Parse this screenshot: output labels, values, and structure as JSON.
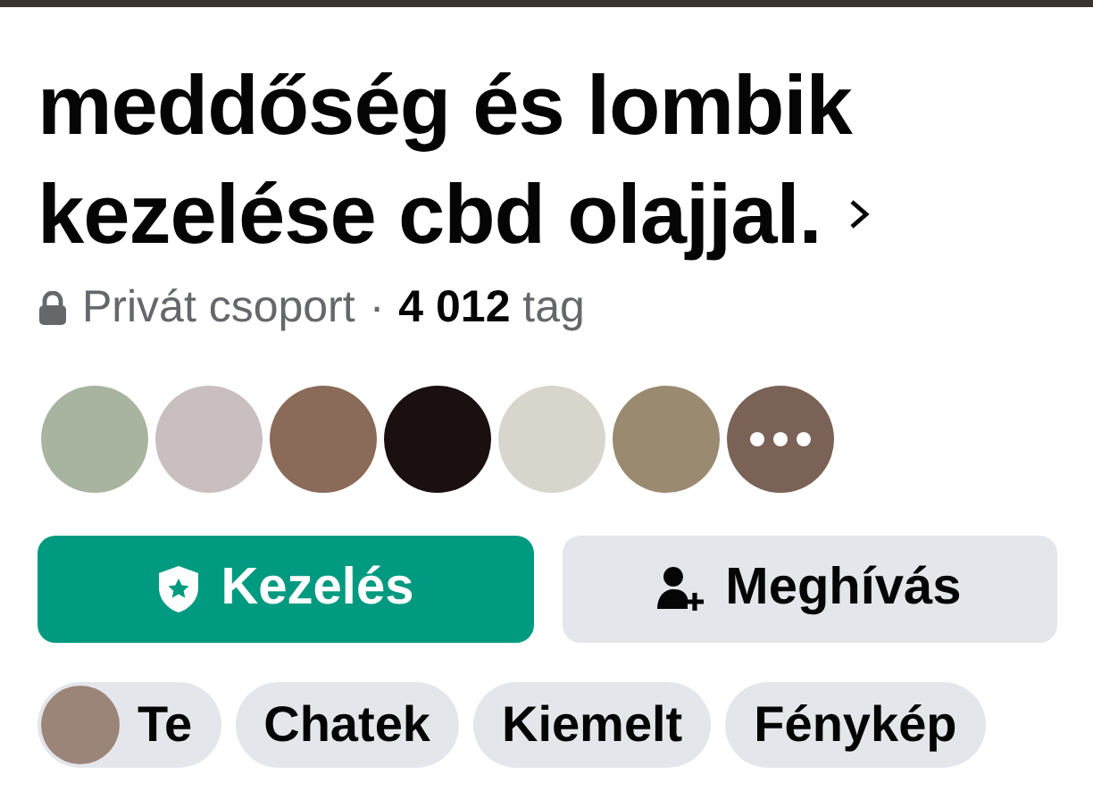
{
  "group": {
    "title_lines": [
      "meddőség és lombik",
      "kezelése cbd olajjal."
    ],
    "privacy": "Privát csoport",
    "separator": "·",
    "member_count": "4 012",
    "member_word": "tag"
  },
  "member_avatars": [
    {
      "kind": "photo"
    },
    {
      "kind": "photo"
    },
    {
      "kind": "photo"
    },
    {
      "kind": "photo"
    },
    {
      "kind": "photo"
    },
    {
      "kind": "photo"
    },
    {
      "kind": "more"
    }
  ],
  "buttons": [
    {
      "label": "Kezelés",
      "kind": "primary"
    },
    {
      "label": "Meghívás",
      "kind": "secondary"
    }
  ],
  "chips": [
    {
      "label": "Te",
      "kind": "avatar"
    },
    {
      "label": "Chatek",
      "kind": "plain"
    },
    {
      "label": "Kiemelt",
      "kind": "plain"
    },
    {
      "label": "Fénykép",
      "kind": "plain"
    }
  ]
}
